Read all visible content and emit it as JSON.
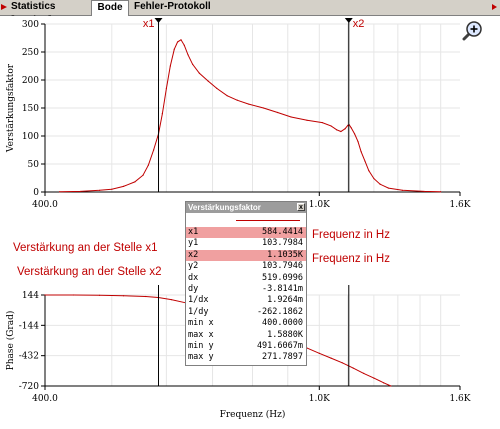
{
  "tabs": [
    {
      "label": "Statistics [Analog]",
      "active": false
    },
    {
      "label": "Bode",
      "active": true
    },
    {
      "label": "Fehler-Protokoll",
      "active": false
    }
  ],
  "zoom_icon": "magnifier-plus-icon",
  "annotations": {
    "x1_left": "Verstärkung an der Stelle x1",
    "x2_left": "Verstärkung an der Stelle x2",
    "x1_right": "Frequenz in Hz",
    "x2_right": "Frequenz in Hz"
  },
  "readout": {
    "title": "Verstärkungsfaktor",
    "close_label": "x",
    "rows": [
      {
        "key": "x1",
        "value": "584.4414",
        "highlight": true
      },
      {
        "key": "y1",
        "value": "103.7984",
        "highlight": false
      },
      {
        "key": "x2",
        "value": "1.1035K",
        "highlight": true
      },
      {
        "key": "y2",
        "value": "103.7946",
        "highlight": false
      },
      {
        "key": "dx",
        "value": "519.0996",
        "highlight": false
      },
      {
        "key": "dy",
        "value": "-3.8141m",
        "highlight": false
      },
      {
        "key": "1/dx",
        "value": "1.9264m",
        "highlight": false
      },
      {
        "key": "1/dy",
        "value": "-262.1862",
        "highlight": false
      },
      {
        "key": "min x",
        "value": "400.0000",
        "highlight": false
      },
      {
        "key": "max x",
        "value": "1.5880K",
        "highlight": false
      },
      {
        "key": "min y",
        "value": "491.6067m",
        "highlight": false
      },
      {
        "key": "max y",
        "value": "271.7897",
        "highlight": false
      }
    ]
  },
  "colors": {
    "trace": "#c00000",
    "cursor": "#000000",
    "highlight": "#f0a0a0",
    "annotation": "#c00000"
  },
  "chart_data": [
    {
      "type": "line",
      "ylabel": "Verstärkungsfaktor",
      "xlabel": "",
      "x_scale": "log",
      "xlim": [
        400,
        1600
      ],
      "ylim": [
        0,
        300
      ],
      "x_tick_labels": [
        {
          "value": 400,
          "label": "400.0"
        },
        {
          "value": 1000,
          "label": "1.0K"
        },
        {
          "value": 1600,
          "label": "1.6K"
        }
      ],
      "y_ticks": [
        0,
        50,
        100,
        150,
        200,
        250,
        300
      ],
      "grid": true,
      "cursors": [
        {
          "name": "x1",
          "x": 584.4414
        },
        {
          "name": "x2",
          "x": 1103.5
        }
      ],
      "series": [
        {
          "values": [
            [
              420,
              0.5
            ],
            [
              450,
              1
            ],
            [
              480,
              3
            ],
            [
              500,
              5
            ],
            [
              520,
              10
            ],
            [
              540,
              18
            ],
            [
              555,
              30
            ],
            [
              565,
              48
            ],
            [
              575,
              75
            ],
            [
              584.4,
              103.8
            ],
            [
              592,
              140
            ],
            [
              600,
              185
            ],
            [
              608,
              225
            ],
            [
              616,
              255
            ],
            [
              623,
              268
            ],
            [
              630,
              271.8
            ],
            [
              637,
              262
            ],
            [
              645,
              245
            ],
            [
              655,
              228
            ],
            [
              670,
              212
            ],
            [
              690,
              198
            ],
            [
              710,
              185
            ],
            [
              735,
              172
            ],
            [
              760,
              164
            ],
            [
              790,
              157
            ],
            [
              830,
              150
            ],
            [
              870,
              142
            ],
            [
              910,
              134
            ],
            [
              960,
              128
            ],
            [
              1010,
              124
            ],
            [
              1040,
              118
            ],
            [
              1060,
              111
            ],
            [
              1075,
              108
            ],
            [
              1090,
              113
            ],
            [
              1100,
              119
            ],
            [
              1105,
              120
            ],
            [
              1112,
              115
            ],
            [
              1125,
              103.8
            ],
            [
              1138,
              90
            ],
            [
              1150,
              72
            ],
            [
              1165,
              55
            ],
            [
              1180,
              38
            ],
            [
              1200,
              24
            ],
            [
              1225,
              14
            ],
            [
              1260,
              7
            ],
            [
              1320,
              3
            ],
            [
              1420,
              1
            ],
            [
              1500,
              0.5
            ]
          ]
        }
      ]
    },
    {
      "type": "line",
      "ylabel": "Phase (Grad)",
      "xlabel": "Frequenz (Hz)",
      "x_scale": "log",
      "xlim": [
        400,
        1600
      ],
      "ylim": [
        -720,
        144
      ],
      "x_tick_labels": [
        {
          "value": 400,
          "label": "400.0"
        },
        {
          "value": 1000,
          "label": "1.0K"
        },
        {
          "value": 1600,
          "label": "1.6K"
        }
      ],
      "y_ticks": [
        144,
        -144,
        -432,
        -720
      ],
      "grid": true,
      "cursors": [
        {
          "name": "x1",
          "x": 584.4414
        },
        {
          "name": "x2",
          "x": 1103.5
        }
      ],
      "series": [
        {
          "values": [
            [
              400,
              144
            ],
            [
              440,
              144
            ],
            [
              480,
              141
            ],
            [
              520,
              137
            ],
            [
              560,
              130
            ],
            [
              584,
              120
            ],
            [
              610,
              100
            ],
            [
              640,
              70
            ],
            [
              680,
              25
            ],
            [
              720,
              -30
            ],
            [
              760,
              -85
            ],
            [
              800,
              -140
            ],
            [
              840,
              -195
            ],
            [
              880,
              -250
            ],
            [
              920,
              -305
            ],
            [
              960,
              -360
            ],
            [
              1000,
              -410
            ],
            [
              1040,
              -455
            ],
            [
              1080,
              -500
            ],
            [
              1120,
              -550
            ],
            [
              1160,
              -600
            ],
            [
              1200,
              -645
            ],
            [
              1240,
              -690
            ],
            [
              1270,
              -720
            ]
          ]
        }
      ]
    }
  ]
}
